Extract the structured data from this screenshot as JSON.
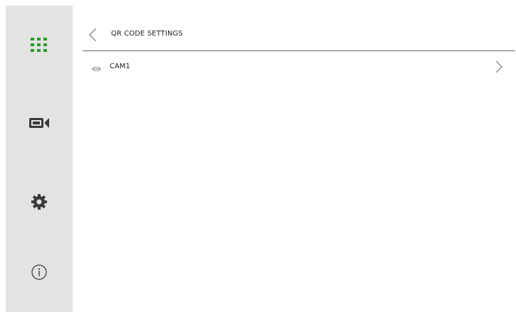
{
  "sidebar": {
    "items": [
      {
        "icon": "grid-apps-icon",
        "color": "#2a9a2a"
      },
      {
        "icon": "camera-icon",
        "color": "#3a3a3a"
      },
      {
        "icon": "gear-icon",
        "color": "#3a3a3a"
      },
      {
        "icon": "info-icon",
        "color": "#3a3a3a"
      }
    ]
  },
  "header": {
    "title": "QR CODE SETTINGS",
    "back_icon": "chevron-left-icon"
  },
  "list": {
    "items": [
      {
        "label": "CAM1",
        "icon": "eye-icon",
        "trailing_icon": "chevron-right-icon"
      }
    ]
  },
  "colors": {
    "sidebar_bg": "#e3e3e3",
    "accent_green": "#2a9a2a",
    "divider": "#6a6a6a"
  }
}
